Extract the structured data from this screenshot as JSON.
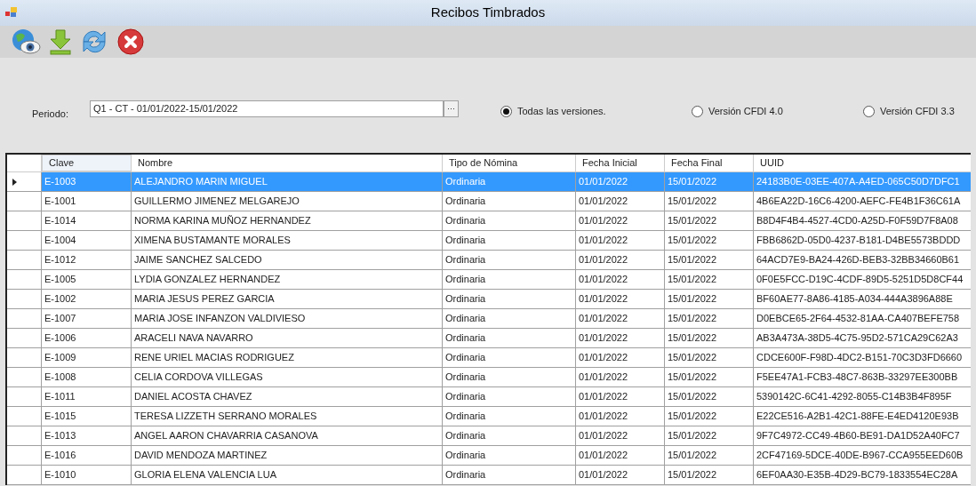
{
  "window": {
    "title": "Recibos Timbrados"
  },
  "toolbar": {
    "buttons": [
      {
        "kind": "view"
      },
      {
        "kind": "download"
      },
      {
        "kind": "refresh"
      },
      {
        "kind": "close"
      }
    ]
  },
  "filters": {
    "periodo_label": "Periodo:",
    "periodo_value": "Q1 - CT - 01/01/2022-15/01/2022",
    "browse_button": "···",
    "versions": [
      {
        "label": "Todas las versiones.",
        "selected": true
      },
      {
        "label": "Versión CFDI 4.0",
        "selected": false
      },
      {
        "label": "Versión CFDI 3.3",
        "selected": false
      }
    ]
  },
  "table": {
    "columns": [
      "Clave",
      "Nombre",
      "Tipo de Nómina",
      "Fecha Inicial",
      "Fecha Final",
      "UUID"
    ],
    "rows": [
      {
        "cells": [
          "E-1003",
          "ALEJANDRO MARIN MIGUEL",
          "Ordinaria",
          "01/01/2022",
          "15/01/2022",
          "24183B0E-03EE-407A-A4ED-065C50D7DFC1"
        ],
        "selected": true
      },
      {
        "cells": [
          "E-1001",
          "GUILLERMO JIMENEZ MELGAREJO",
          "Ordinaria",
          "01/01/2022",
          "15/01/2022",
          "4B6EA22D-16C6-4200-AEFC-FE4B1F36C61A"
        ],
        "selected": false
      },
      {
        "cells": [
          "E-1014",
          "NORMA KARINA MUÑOZ HERNANDEZ",
          "Ordinaria",
          "01/01/2022",
          "15/01/2022",
          "B8D4F4B4-4527-4CD0-A25D-F0F59D7F8A08"
        ],
        "selected": false
      },
      {
        "cells": [
          "E-1004",
          "XIMENA BUSTAMANTE MORALES",
          "Ordinaria",
          "01/01/2022",
          "15/01/2022",
          "FBB6862D-05D0-4237-B181-D4BE5573BDDD"
        ],
        "selected": false
      },
      {
        "cells": [
          "E-1012",
          "JAIME SANCHEZ SALCEDO",
          "Ordinaria",
          "01/01/2022",
          "15/01/2022",
          "64ACD7E9-BA24-426D-BEB3-32BB34660B61"
        ],
        "selected": false
      },
      {
        "cells": [
          "E-1005",
          "LYDIA GONZALEZ HERNANDEZ",
          "Ordinaria",
          "01/01/2022",
          "15/01/2022",
          "0F0E5FCC-D19C-4CDF-89D5-5251D5D8CF44"
        ],
        "selected": false
      },
      {
        "cells": [
          "E-1002",
          "MARIA JESUS PEREZ GARCIA",
          "Ordinaria",
          "01/01/2022",
          "15/01/2022",
          "BF60AE77-8A86-4185-A034-444A3896A88E"
        ],
        "selected": false
      },
      {
        "cells": [
          "E-1007",
          "MARIA JOSE INFANZON VALDIVIESO",
          "Ordinaria",
          "01/01/2022",
          "15/01/2022",
          "D0EBCE65-2F64-4532-81AA-CA407BEFE758"
        ],
        "selected": false
      },
      {
        "cells": [
          "E-1006",
          "ARACELI NAVA NAVARRO",
          "Ordinaria",
          "01/01/2022",
          "15/01/2022",
          "AB3A473A-38D5-4C75-95D2-571CA29C62A3"
        ],
        "selected": false
      },
      {
        "cells": [
          "E-1009",
          "RENE URIEL MACIAS RODRIGUEZ",
          "Ordinaria",
          "01/01/2022",
          "15/01/2022",
          "CDCE600F-F98D-4DC2-B151-70C3D3FD6660"
        ],
        "selected": false
      },
      {
        "cells": [
          "E-1008",
          "CELIA CORDOVA VILLEGAS",
          "Ordinaria",
          "01/01/2022",
          "15/01/2022",
          "F5EE47A1-FCB3-48C7-863B-33297EE300BB"
        ],
        "selected": false
      },
      {
        "cells": [
          "E-1011",
          "DANIEL ACOSTA CHAVEZ",
          "Ordinaria",
          "01/01/2022",
          "15/01/2022",
          "5390142C-6C41-4292-8055-C14B3B4F895F"
        ],
        "selected": false
      },
      {
        "cells": [
          "E-1015",
          "TERESA LIZZETH SERRANO MORALES",
          "Ordinaria",
          "01/01/2022",
          "15/01/2022",
          "E22CE516-A2B1-42C1-88FE-E4ED4120E93B"
        ],
        "selected": false
      },
      {
        "cells": [
          "E-1013",
          "ANGEL AARON CHAVARRIA CASANOVA",
          "Ordinaria",
          "01/01/2022",
          "15/01/2022",
          "9F7C4972-CC49-4B60-BE91-DA1D52A40FC7"
        ],
        "selected": false
      },
      {
        "cells": [
          "E-1016",
          "DAVID MENDOZA MARTINEZ",
          "Ordinaria",
          "01/01/2022",
          "15/01/2022",
          "2CF47169-5DCE-40DE-B967-CCA955EED60B"
        ],
        "selected": false
      },
      {
        "cells": [
          "E-1010",
          "GLORIA ELENA VALENCIA LUA",
          "Ordinaria",
          "01/01/2022",
          "15/01/2022",
          "6EF0AA30-E35B-4D29-BC79-1833554EC28A"
        ],
        "selected": false
      }
    ]
  }
}
